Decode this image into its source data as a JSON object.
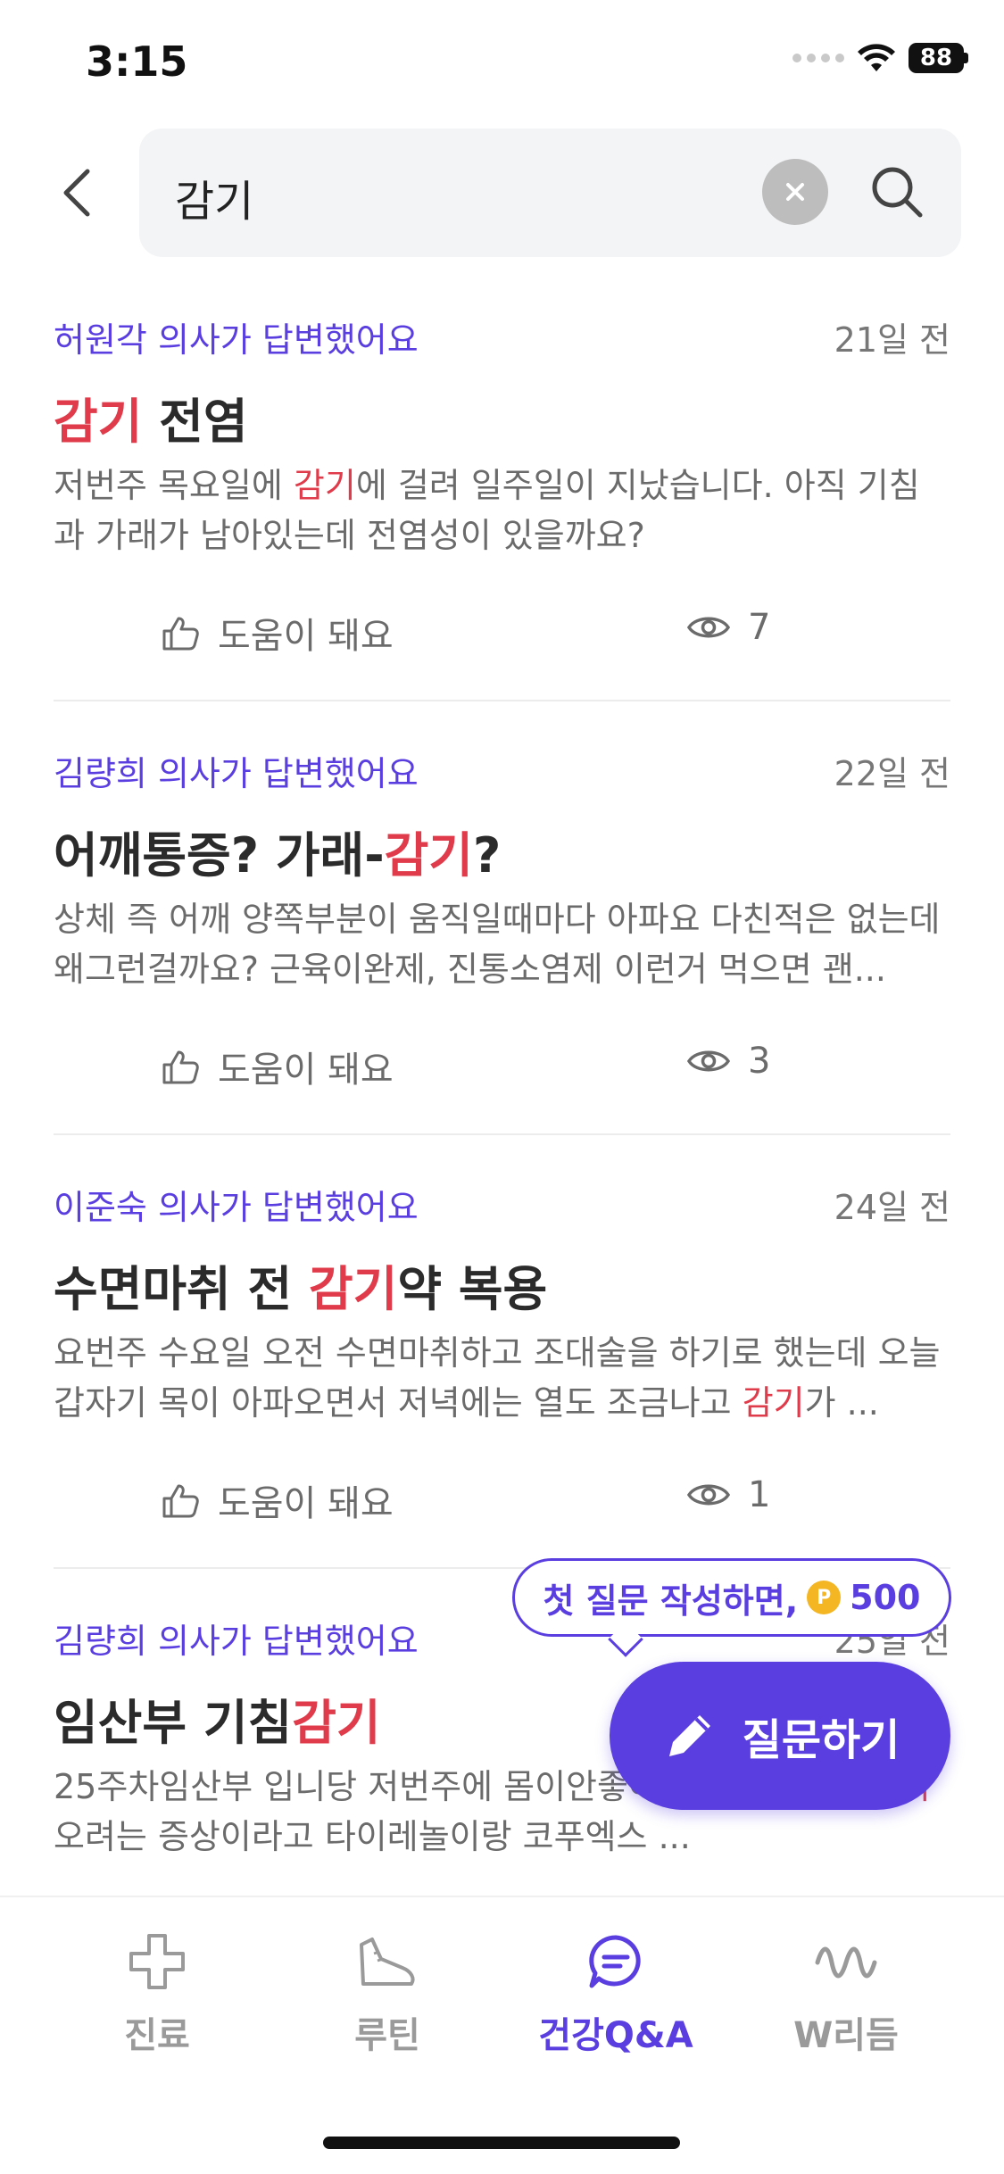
{
  "status_bar": {
    "time": "3:15",
    "battery": "88"
  },
  "search": {
    "query": "감기"
  },
  "results": [
    {
      "doctor": "허원각 의사가 답변했어요",
      "date": "21일 전",
      "title_parts": [
        {
          "text": "감기",
          "hl": true
        },
        {
          "text": " 전염",
          "hl": false
        }
      ],
      "body_parts": [
        {
          "text": "저번주 목요일에 ",
          "hl": false
        },
        {
          "text": "감기",
          "hl": true
        },
        {
          "text": "에 걸려 일주일이 지났습니다. 아직 기침과 가래가 남아있는데 전염성이 있을까요?",
          "hl": false
        }
      ],
      "helpful_label": "도움이 돼요",
      "views": "7"
    },
    {
      "doctor": "김량희 의사가 답변했어요",
      "date": "22일 전",
      "title_parts": [
        {
          "text": "어깨통증? 가래-",
          "hl": false
        },
        {
          "text": "감기",
          "hl": true
        },
        {
          "text": "?",
          "hl": false
        }
      ],
      "body_parts": [
        {
          "text": "상체 즉 어깨 양쪽부분이 움직일때마다 아파요 다친적은 없는데 왜그런걸까요? 근육이완제, 진통소염제 이런거 먹으면 괜...",
          "hl": false
        }
      ],
      "helpful_label": "도움이 돼요",
      "views": "3"
    },
    {
      "doctor": "이준숙 의사가 답변했어요",
      "date": "24일 전",
      "title_parts": [
        {
          "text": "수면마취 전 ",
          "hl": false
        },
        {
          "text": "감기",
          "hl": true
        },
        {
          "text": "약 복용",
          "hl": false
        }
      ],
      "body_parts": [
        {
          "text": "요번주 수요일 오전 수면마취하고 조대술을 하기로 했는데 오늘 갑자기 목이 아파오면서 저녁에는 열도 조금나고 ",
          "hl": false
        },
        {
          "text": "감기",
          "hl": true
        },
        {
          "text": "가 ...",
          "hl": false
        }
      ],
      "helpful_label": "도움이 돼요",
      "views": "1"
    },
    {
      "doctor": "김량희 의사가 답변했어요",
      "date": "25일 전",
      "title_parts": [
        {
          "text": "임산부 기침",
          "hl": false
        },
        {
          "text": "감기",
          "hl": true
        }
      ],
      "body_parts": [
        {
          "text": "25주차임산부 입니당 저번주에 몸이안좋아서 내과갔더니 ",
          "hl": false
        },
        {
          "text": "감기",
          "hl": true
        },
        {
          "text": "오려는 증상이라고 타이레놀이랑 코푸엑스 ...",
          "hl": false
        }
      ],
      "helpful_label": "도움이 돼요",
      "views": ""
    }
  ],
  "tooltip": {
    "text": "첫 질문 작성하면,",
    "coin_label": "P",
    "amount": "500"
  },
  "fab": {
    "label": "질문하기"
  },
  "tabs": [
    {
      "label": "진료",
      "icon": "plus-cross-icon",
      "active": false
    },
    {
      "label": "루틴",
      "icon": "sneaker-icon",
      "active": false
    },
    {
      "label": "건강Q&A",
      "icon": "chat-bubble-icon",
      "active": true
    },
    {
      "label": "W리듬",
      "icon": "wave-icon",
      "active": false
    }
  ],
  "colors": {
    "accent": "#5a3ee0",
    "highlight": "#e03b4a",
    "muted": "#6b6b6b"
  }
}
